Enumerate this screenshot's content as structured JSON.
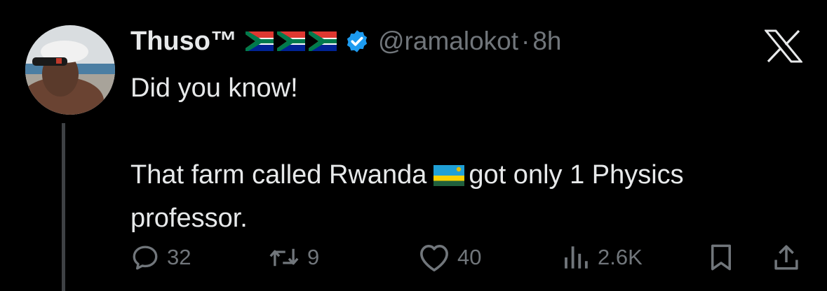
{
  "tweet": {
    "display_name": "Thuso™",
    "name_flags": [
      "south-africa-flag",
      "south-africa-flag",
      "south-africa-flag"
    ],
    "verified": true,
    "handle": "@ramalokot",
    "separator": "·",
    "time": "8h",
    "text": {
      "line1": "Did you know!",
      "line2_before_flag": "That farm called Rwanda",
      "inline_flag": "rwanda-flag",
      "line2_after_flag": "got only 1 Physics",
      "line3": "professor."
    }
  },
  "metrics": {
    "replies": "32",
    "reposts": "9",
    "likes": "40",
    "views": "2.6K"
  },
  "colors": {
    "background": "#000000",
    "text_primary": "#e7e9ea",
    "text_secondary": "#71767b",
    "verified_blue": "#1d9bf0",
    "thread_line": "#3e4144"
  },
  "icons": {
    "platform_logo": "x-logo-icon",
    "reply": "reply-icon",
    "repost": "repost-icon",
    "like": "heart-icon",
    "views": "views-icon",
    "bookmark": "bookmark-icon",
    "share": "share-icon"
  }
}
